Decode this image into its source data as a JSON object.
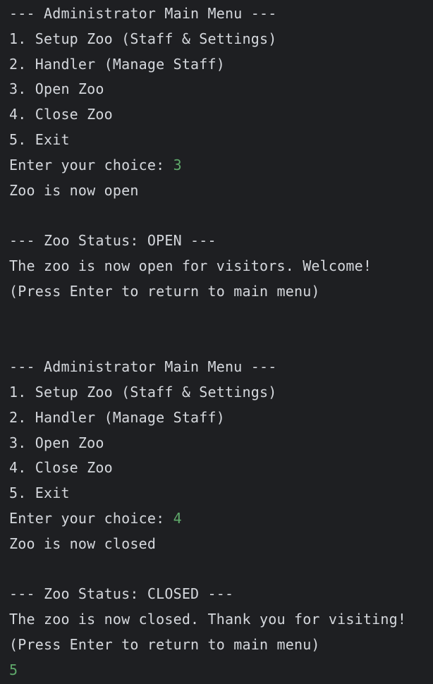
{
  "console": {
    "lines": [
      {
        "text": "--- Administrator Main Menu ---"
      },
      {
        "text": "1. Setup Zoo (Staff & Settings)"
      },
      {
        "text": "2. Handler (Manage Staff)"
      },
      {
        "text": "3. Open Zoo"
      },
      {
        "text": "4. Close Zoo"
      },
      {
        "text": "5. Exit"
      },
      {
        "text": "Enter your choice: ",
        "input": "3"
      },
      {
        "text": "Zoo is now open"
      },
      {
        "text": ""
      },
      {
        "text": "--- Zoo Status: OPEN ---"
      },
      {
        "text": "The zoo is now open for visitors. Welcome!"
      },
      {
        "text": "(Press Enter to return to main menu)"
      },
      {
        "text": ""
      },
      {
        "text": ""
      },
      {
        "text": "--- Administrator Main Menu ---"
      },
      {
        "text": "1. Setup Zoo (Staff & Settings)"
      },
      {
        "text": "2. Handler (Manage Staff)"
      },
      {
        "text": "3. Open Zoo"
      },
      {
        "text": "4. Close Zoo"
      },
      {
        "text": "5. Exit"
      },
      {
        "text": "Enter your choice: ",
        "input": "4"
      },
      {
        "text": "Zoo is now closed"
      },
      {
        "text": ""
      },
      {
        "text": "--- Zoo Status: CLOSED ---"
      },
      {
        "text": "The zoo is now closed. Thank you for visiting!"
      },
      {
        "text": "(Press Enter to return to main menu)"
      },
      {
        "text": "",
        "input": "5"
      }
    ]
  },
  "colors": {
    "background": "#1e1f22",
    "output_text": "#d5d8dd",
    "user_input": "#5fa96b"
  }
}
